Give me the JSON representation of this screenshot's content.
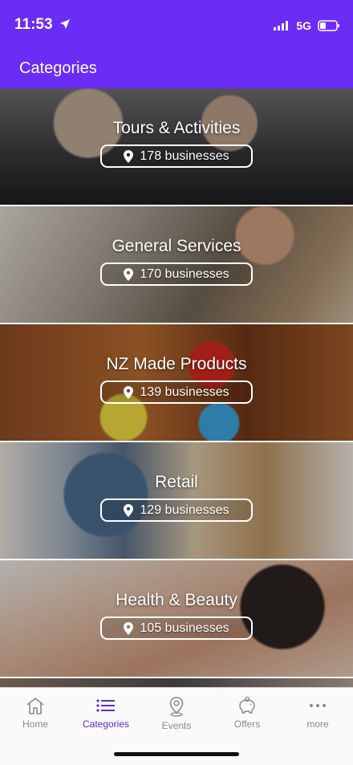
{
  "status": {
    "time": "11:53",
    "network": "5G"
  },
  "header": {
    "title": "Categories"
  },
  "categories": [
    {
      "name": "Tours & Activities",
      "count": "178 businesses"
    },
    {
      "name": "General Services",
      "count": "170 businesses"
    },
    {
      "name": "NZ Made Products",
      "count": "139 businesses"
    },
    {
      "name": "Retail",
      "count": "129 businesses"
    },
    {
      "name": "Health & Beauty",
      "count": "105 businesses"
    }
  ],
  "tabs": [
    {
      "label": "Home",
      "icon": "home-icon"
    },
    {
      "label": "Categories",
      "icon": "list-icon"
    },
    {
      "label": "Events",
      "icon": "map-pin-icon"
    },
    {
      "label": "Offers",
      "icon": "piggy-bank-icon"
    },
    {
      "label": "more",
      "icon": "more-dots-icon"
    }
  ],
  "colors": {
    "brand": "#6b2cf5",
    "active_tab": "#5b2bd6",
    "inactive_tab": "#8a8a8a"
  }
}
